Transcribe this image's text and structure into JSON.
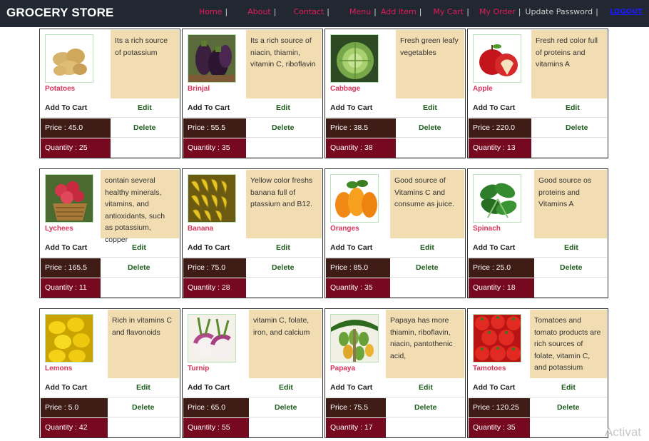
{
  "navbar": {
    "brand": "GROCERY STORE",
    "items": [
      {
        "label": "Home",
        "style": "pink"
      },
      {
        "label": "About",
        "style": "pink"
      },
      {
        "label": "Contact",
        "style": "pink"
      },
      {
        "label": "Menu",
        "style": "pink"
      },
      {
        "label": "Add Item",
        "style": "pink"
      },
      {
        "label": "My Cart",
        "style": "pink"
      },
      {
        "label": "My Order",
        "style": "pink"
      },
      {
        "label": "Update Password",
        "style": "muted"
      }
    ],
    "separator": "|",
    "logout": "LOGOUT"
  },
  "labels": {
    "add_to_cart": "Add To Cart",
    "edit": "Edit",
    "delete": "Delete",
    "price_prefix": "Price : ",
    "qty_prefix": "Quantity : "
  },
  "products": [
    {
      "name": "Potatoes",
      "desc": "Its a rich source of potassium",
      "price": "45.0",
      "qty": "25",
      "icon": "potato-icon",
      "price_display": "Price : 45.0",
      "qty_display": "Quantity : 25"
    },
    {
      "name": "Brinjal",
      "desc": "Its a rich source of niacin, thiamin, vitamin C, riboflavin",
      "price": "55.5",
      "qty": "35",
      "icon": "eggplant-icon",
      "price_display": "Price : 55.5",
      "qty_display": "Quantity : 35"
    },
    {
      "name": "Cabbage",
      "desc": "Fresh green leafy vegetables",
      "price": "38.5",
      "qty": "38",
      "icon": "cabbage-icon",
      "price_display": "Price : 38.5",
      "qty_display": "Quantity : 38"
    },
    {
      "name": "Apple",
      "desc": "Fresh red color full of proteins and vitamins A",
      "price": "220.0",
      "qty": "13",
      "icon": "apple-icon",
      "price_display": "Price : 220.0",
      "qty_display": "Quantity : 13"
    },
    {
      "name": "Lychees",
      "desc": "contain several healthy minerals, vitamins, and antioxidants, such as potassium, copper",
      "price": "165.5",
      "qty": "11",
      "icon": "lychee-icon",
      "price_display": "Price : 165.5",
      "qty_display": "Quantity : 11"
    },
    {
      "name": "Banana",
      "desc": "Yellow color freshs banana full of ptassium and B12.",
      "price": "75.0",
      "qty": "28",
      "icon": "banana-icon",
      "price_display": "Price : 75.0",
      "qty_display": "Quantity : 28"
    },
    {
      "name": "Oranges",
      "desc": "Good source of Vitamins C and consume as juice.",
      "price": "85.0",
      "qty": "35",
      "icon": "orange-icon",
      "price_display": "Price : 85.0",
      "qty_display": "Quantity : 35"
    },
    {
      "name": "Spinach",
      "desc": "Good source os proteins and Vitamins A",
      "price": "25.0",
      "qty": "18",
      "icon": "spinach-icon",
      "price_display": "Price : 25.0",
      "qty_display": "Quantity : 18"
    },
    {
      "name": "Lemons",
      "desc": "Rich in vitamins C and flavonoids",
      "price": "5.0",
      "qty": "42",
      "icon": "lemon-icon",
      "price_display": "Price : 5.0",
      "qty_display": "Quantity : 42"
    },
    {
      "name": "Turnip",
      "desc": "vitamin C, folate, iron, and calcium",
      "price": "65.0",
      "qty": "55",
      "icon": "turnip-icon",
      "price_display": "Price : 65.0",
      "qty_display": "Quantity : 55"
    },
    {
      "name": "Papaya",
      "desc": "Papaya has more thiamin, riboflavin, niacin, pantothenic acid,",
      "price": "75.5",
      "qty": "17",
      "icon": "papaya-icon",
      "price_display": "Price : 75.5",
      "qty_display": "Quantity : 17"
    },
    {
      "name": "Tamotoes",
      "desc": "Tomatoes and tomato products are rich sources of folate, vitamin C, and potassium",
      "price": "120.25",
      "qty": "35",
      "icon": "tomato-icon",
      "price_display": "Price : 120.25",
      "qty_display": "Quantity : 35"
    }
  ],
  "watermark": "Activat"
}
